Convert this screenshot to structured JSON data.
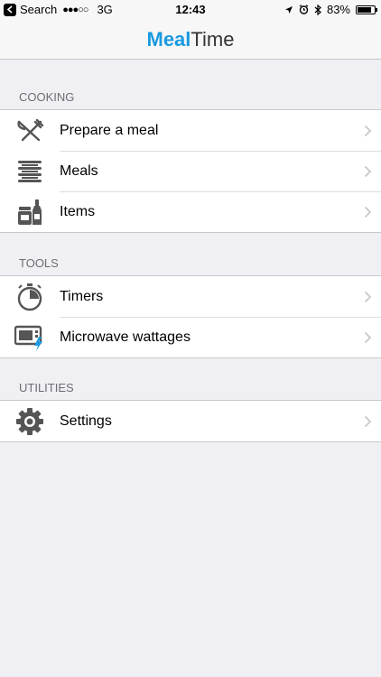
{
  "status_bar": {
    "carrier": "Search",
    "signal": "●●●○○",
    "network": "3G",
    "time": "12:43",
    "battery": "83%",
    "battery_level": 0.83
  },
  "nav": {
    "title_part1": "Meal",
    "title_part2": "Time"
  },
  "sections": {
    "cooking": {
      "header": "COOKING",
      "items": [
        {
          "label": "Prepare a meal"
        },
        {
          "label": "Meals"
        },
        {
          "label": "Items"
        }
      ]
    },
    "tools": {
      "header": "TOOLS",
      "items": [
        {
          "label": "Timers"
        },
        {
          "label": "Microwave wattages"
        }
      ]
    },
    "utilities": {
      "header": "UTILITIES",
      "items": [
        {
          "label": "Settings"
        }
      ]
    }
  },
  "colors": {
    "brand": "#1a9ae0",
    "background": "#efeff4",
    "chevron": "#c7c7cc"
  }
}
